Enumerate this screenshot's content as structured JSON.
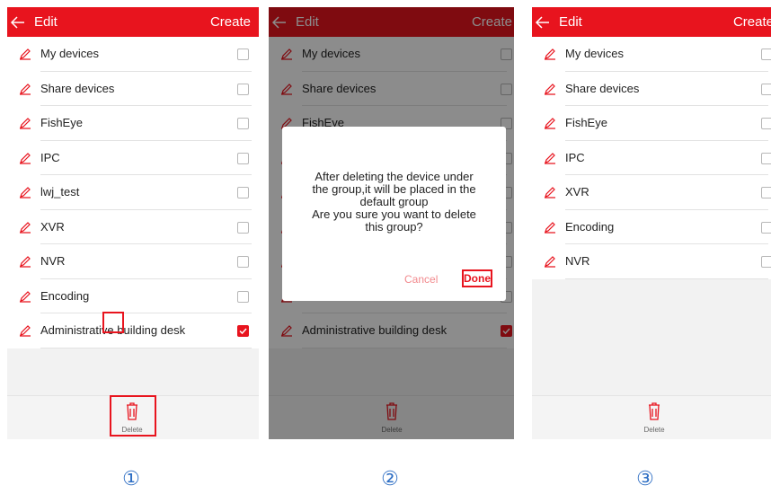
{
  "colors": {
    "accent": "#e8141e",
    "label": "#2f6fc4"
  },
  "icons": {
    "back": "arrow-left-icon",
    "edit": "pencil-icon",
    "delete": "trash-icon",
    "check": "checkmark-icon"
  },
  "screens": [
    {
      "title": "Edit",
      "create": "Create",
      "items": [
        {
          "label": "My devices",
          "checked": false
        },
        {
          "label": "Share devices",
          "checked": false
        },
        {
          "label": "FishEye",
          "checked": false
        },
        {
          "label": "IPC",
          "checked": false
        },
        {
          "label": "lwj_test",
          "checked": false
        },
        {
          "label": "XVR",
          "checked": false
        },
        {
          "label": "NVR",
          "checked": false
        },
        {
          "label": "Encoding",
          "checked": false
        },
        {
          "label": "Administrative building desk",
          "checked": true
        }
      ],
      "delete_label": "Delete"
    },
    {
      "title": "Edit",
      "create": "Create",
      "items": [
        {
          "label": "My devices",
          "checked": false
        },
        {
          "label": "Share devices",
          "checked": false
        },
        {
          "label": "FishEye",
          "checked": false
        },
        {
          "label": "",
          "checked": false
        },
        {
          "label": "",
          "checked": false
        },
        {
          "label": "",
          "checked": false
        },
        {
          "label": "",
          "checked": false
        },
        {
          "label": "",
          "checked": false
        },
        {
          "label": "Administrative building desk",
          "checked": true
        }
      ],
      "delete_label": "Delete",
      "dialog": {
        "message": [
          "After deleting the device under",
          "the group,it will be placed in the",
          "default group",
          "Are you sure you want to delete",
          "this group?"
        ],
        "cancel": "Cancel",
        "done": "Done"
      }
    },
    {
      "title": "Edit",
      "create": "Create",
      "items": [
        {
          "label": "My devices",
          "checked": false
        },
        {
          "label": "Share devices",
          "checked": false
        },
        {
          "label": "FishEye",
          "checked": false
        },
        {
          "label": "IPC",
          "checked": false
        },
        {
          "label": "XVR",
          "checked": false
        },
        {
          "label": "Encoding",
          "checked": false
        },
        {
          "label": "NVR",
          "checked": false
        }
      ],
      "delete_label": "Delete"
    }
  ],
  "step_labels": [
    "①",
    "②",
    "③"
  ]
}
